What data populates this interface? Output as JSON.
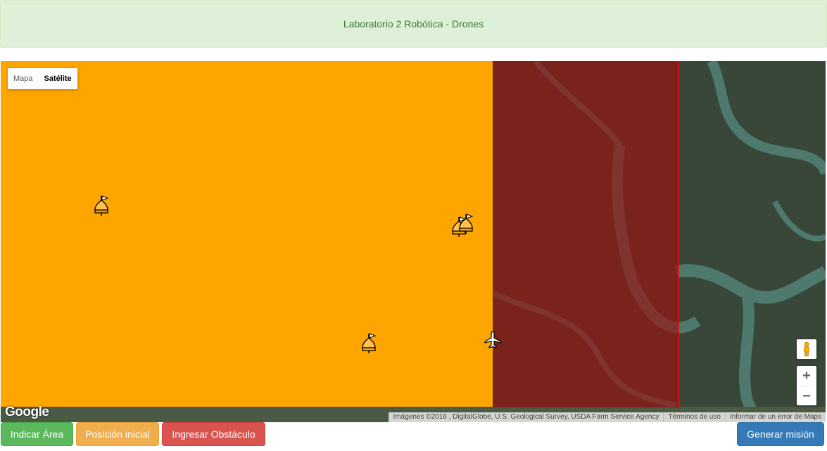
{
  "header": {
    "title": "Laboratorio 2 Robótica - Drones"
  },
  "map": {
    "type_controls": {
      "map_label": "Mapa",
      "satellite_label": "Satélite",
      "selected": "Satélite"
    },
    "logo": "Google",
    "attribution": {
      "imagery": "Imágenes ©2016 , DigitalGlobe, U.S. Geological Survey, USDA Farm Service Agency",
      "terms": "Términos de uso",
      "report": "Informar de un error de Maps"
    },
    "zoom": {
      "in": "+",
      "out": "−"
    },
    "area_color": "#ffa500",
    "obstacle_color": "#a00a0a"
  },
  "buttons": {
    "indicate_area": "Indicar Área",
    "initial_position": "Posición inicial",
    "add_obstacle": "Ingresar Obstáculo",
    "generate_mission": "Generar misión"
  }
}
